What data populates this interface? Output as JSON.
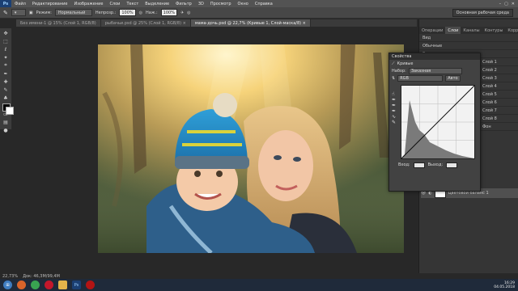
{
  "menubar": {
    "logo": "Ps",
    "items": [
      "Файл",
      "Редактирование",
      "Изображение",
      "Слои",
      "Текст",
      "Выделение",
      "Фильтр",
      "3D",
      "Просмотр",
      "Окно",
      "Справка"
    ],
    "window_controls": [
      "–",
      "▢",
      "✕"
    ]
  },
  "optionsbar": {
    "mode_label": "Режим:",
    "mode_value": "Нормальный",
    "opacity_label": "Непрозр.:",
    "opacity_value": "100%",
    "flow_label": "Наж.:",
    "flow_value": "100%",
    "workspace": "Основная рабочая среда"
  },
  "doctabs": [
    {
      "label": "Без имени-1 @ 15% (Слой 1, RGB/8)",
      "active": false
    },
    {
      "label": "рыбачьи.psd @ 25% (Слой 1, RGB/8) ×",
      "active": false
    },
    {
      "label": "мама-дочь.psd @ 22,7% (Кривые 1, Слой-маска/8) ×",
      "active": true
    }
  ],
  "status": {
    "zoom": "22,73%",
    "doc": "Док: 46,3М/99,4М"
  },
  "panels": {
    "tabs_top": [
      "Операции",
      "Слои",
      "Каналы",
      "Контуры",
      "Коррекция"
    ],
    "layer_rows": [
      "Вид",
      "Обычные",
      "Закрепить:",
      "Слой 1",
      "Слой 2",
      "Слой 3",
      "Слой 4",
      "Слой 5",
      "Слой 6",
      "Слой 7",
      "Слой 8",
      "Фон"
    ],
    "layer_thumb_label": "Цветовой баланс 1"
  },
  "properties": {
    "title": "Свойства",
    "type": "Кривые",
    "preset_label": "Набор:",
    "preset_value": "Заказная",
    "channel_value": "RGB",
    "auto_label": "Авто",
    "input_label": "Вход:",
    "input_value": "0",
    "output_label": "Выход:",
    "output_value": "0"
  },
  "taskbar": {
    "icons": [
      "Пуск",
      "Firefox",
      "Chrome",
      "Opera",
      "Проводник",
      "Ps",
      "Запись"
    ],
    "time": "16:29",
    "date": "04.05.2018"
  },
  "colors": {
    "ps_blue": "#1b3f73",
    "panel_bg": "#353535",
    "workspace_bg": "#282828"
  }
}
